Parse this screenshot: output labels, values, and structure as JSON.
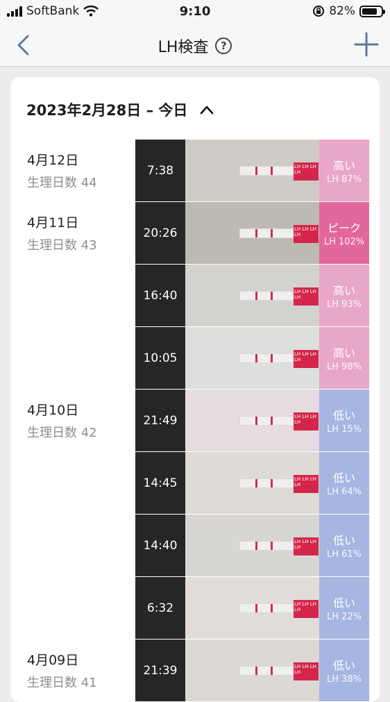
{
  "status_bar": {
    "carrier": "SoftBank",
    "time": "9:10",
    "battery": "82%",
    "battery_level": 0.82
  },
  "nav": {
    "title": "LH検査",
    "help": "?"
  },
  "range": {
    "label": "2023年2月28日 – 今日"
  },
  "days": [
    {
      "date": "4月12日",
      "cycle": "生理日数 44"
    },
    {
      "date": "4月11日",
      "cycle": "生理日数 43"
    },
    {
      "date": "4月10日",
      "cycle": "生理日数 42"
    },
    {
      "date": "4月09日",
      "cycle": "生理日数 41"
    }
  ],
  "entries": [
    {
      "time": "7:38",
      "level": "高い",
      "lh": "LH 87%",
      "kind": "high",
      "photo": "#cfcbc6"
    },
    {
      "time": "20:26",
      "level": "ピーク",
      "lh": "LH 102%",
      "kind": "peak",
      "photo": "#bdbab4"
    },
    {
      "time": "16:40",
      "level": "高い",
      "lh": "LH 93%",
      "kind": "high",
      "photo": "#d4d2cf"
    },
    {
      "time": "10:05",
      "level": "高い",
      "lh": "LH 98%",
      "kind": "high",
      "photo": "#dcdfdc"
    },
    {
      "time": "21:49",
      "level": "低い",
      "lh": "LH 15%",
      "kind": "low",
      "photo": "#e6dbe0"
    },
    {
      "time": "14:45",
      "level": "低い",
      "lh": "LH 64%",
      "kind": "low",
      "photo": "#dedad6"
    },
    {
      "time": "14:40",
      "level": "低い",
      "lh": "LH 61%",
      "kind": "low",
      "photo": "#d8d6d3"
    },
    {
      "time": "6:32",
      "level": "低い",
      "lh": "LH 22%",
      "kind": "low",
      "photo": "#e2dcd9"
    },
    {
      "time": "21:39",
      "level": "低い",
      "lh": "LH 38%",
      "kind": "low",
      "photo": "#dcd8d4"
    }
  ],
  "colors": {
    "high": "#e8a6c8",
    "peak": "#e2679c",
    "low": "#a6b6e2",
    "test_line": "#c8304a"
  }
}
